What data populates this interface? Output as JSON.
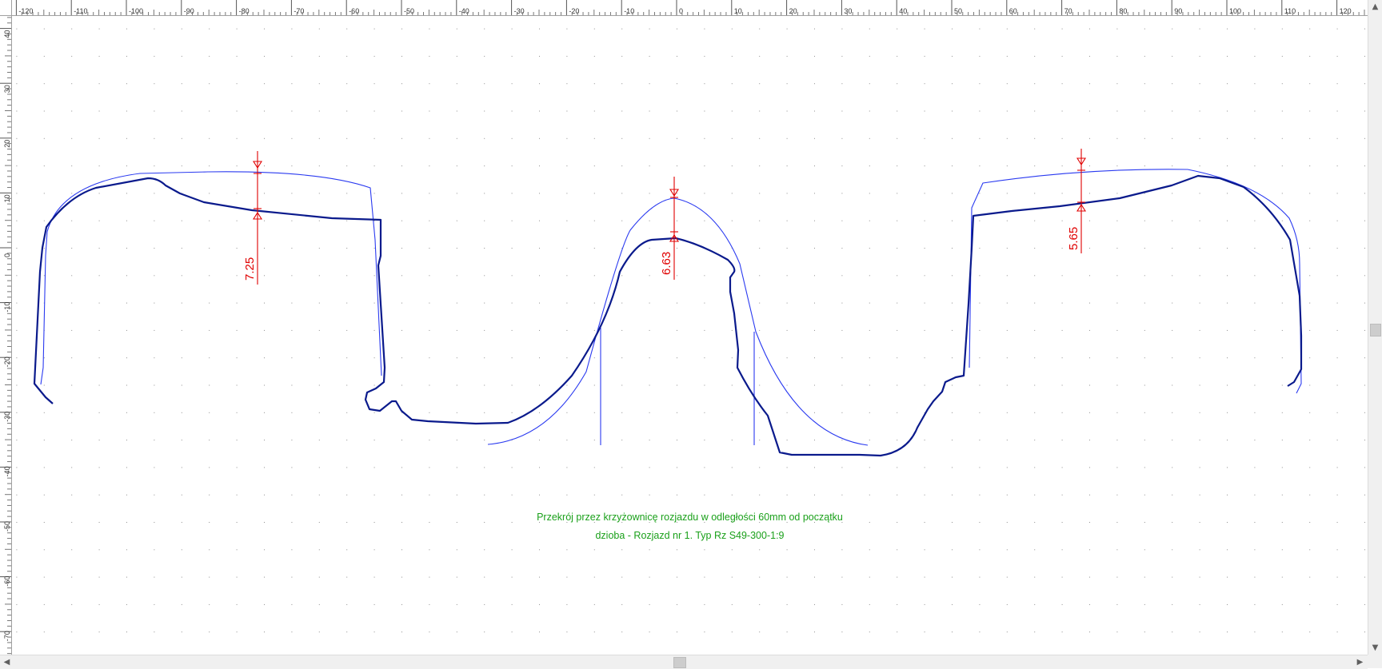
{
  "ruler_x": {
    "labels": [
      "-120",
      "-110",
      "-100",
      "-90",
      "-80",
      "-70",
      "-60",
      "-50",
      "-40",
      "-30",
      "-20",
      "-10",
      "0",
      "10",
      "20",
      "30",
      "40",
      "50",
      "60",
      "70",
      "80",
      "90",
      "100",
      "110",
      "120"
    ]
  },
  "ruler_y": {
    "labels": [
      "60",
      "50",
      "40",
      "30",
      "20",
      "10",
      "0",
      "-10",
      "-20",
      "-30",
      "-40",
      "-50",
      "-60",
      "-70"
    ]
  },
  "measurements": [
    {
      "label": "7.25"
    },
    {
      "label": "6.63"
    },
    {
      "label": "5.65"
    }
  ],
  "caption": {
    "line1": "Przekrój przez krzyżownicę rozjazdu w odległości 60mm od początku",
    "line2": "dzioba - Rozjazd nr 1. Typ Rz S49-300-1:9"
  },
  "colors": {
    "measured_profile": "#0a1a8c",
    "nominal_profile": "#2a3af0",
    "dimension": "#e00000",
    "grid_dot": "#909090",
    "caption": "#1aa01a"
  },
  "icons": {
    "scroll_up": "chevron-up-icon",
    "scroll_down": "chevron-down-icon",
    "scroll_left": "chevron-left-icon",
    "scroll_right": "chevron-right-icon"
  }
}
